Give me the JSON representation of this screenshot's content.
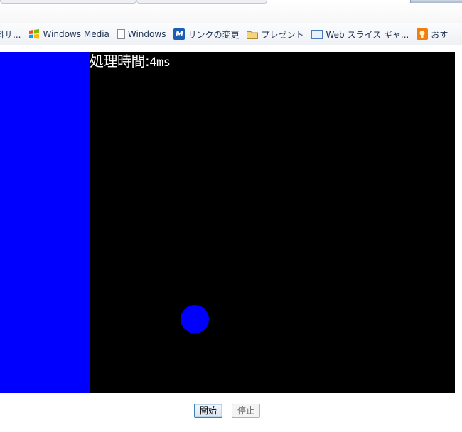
{
  "favorites": [
    {
      "label": "料サ...",
      "icon": "none"
    },
    {
      "label": "Windows Media",
      "icon": "windows-flag-icon"
    },
    {
      "label": "Windows",
      "icon": "page-icon"
    },
    {
      "label": "リンクの変更",
      "icon": "msn-icon"
    },
    {
      "label": "プレゼント",
      "icon": "folder-icon"
    },
    {
      "label": "Web スライス ギャ...",
      "icon": "web-slice-icon"
    },
    {
      "label": "おす",
      "icon": "lightbulb-icon"
    }
  ],
  "canvas": {
    "background": "#000000",
    "paddle_color": "#0000ff",
    "ball_color": "#0000ff",
    "timer_label": "処理時間:",
    "timer_value": "4ms"
  },
  "controls": {
    "start_label": "開始",
    "stop_label": "停止"
  }
}
